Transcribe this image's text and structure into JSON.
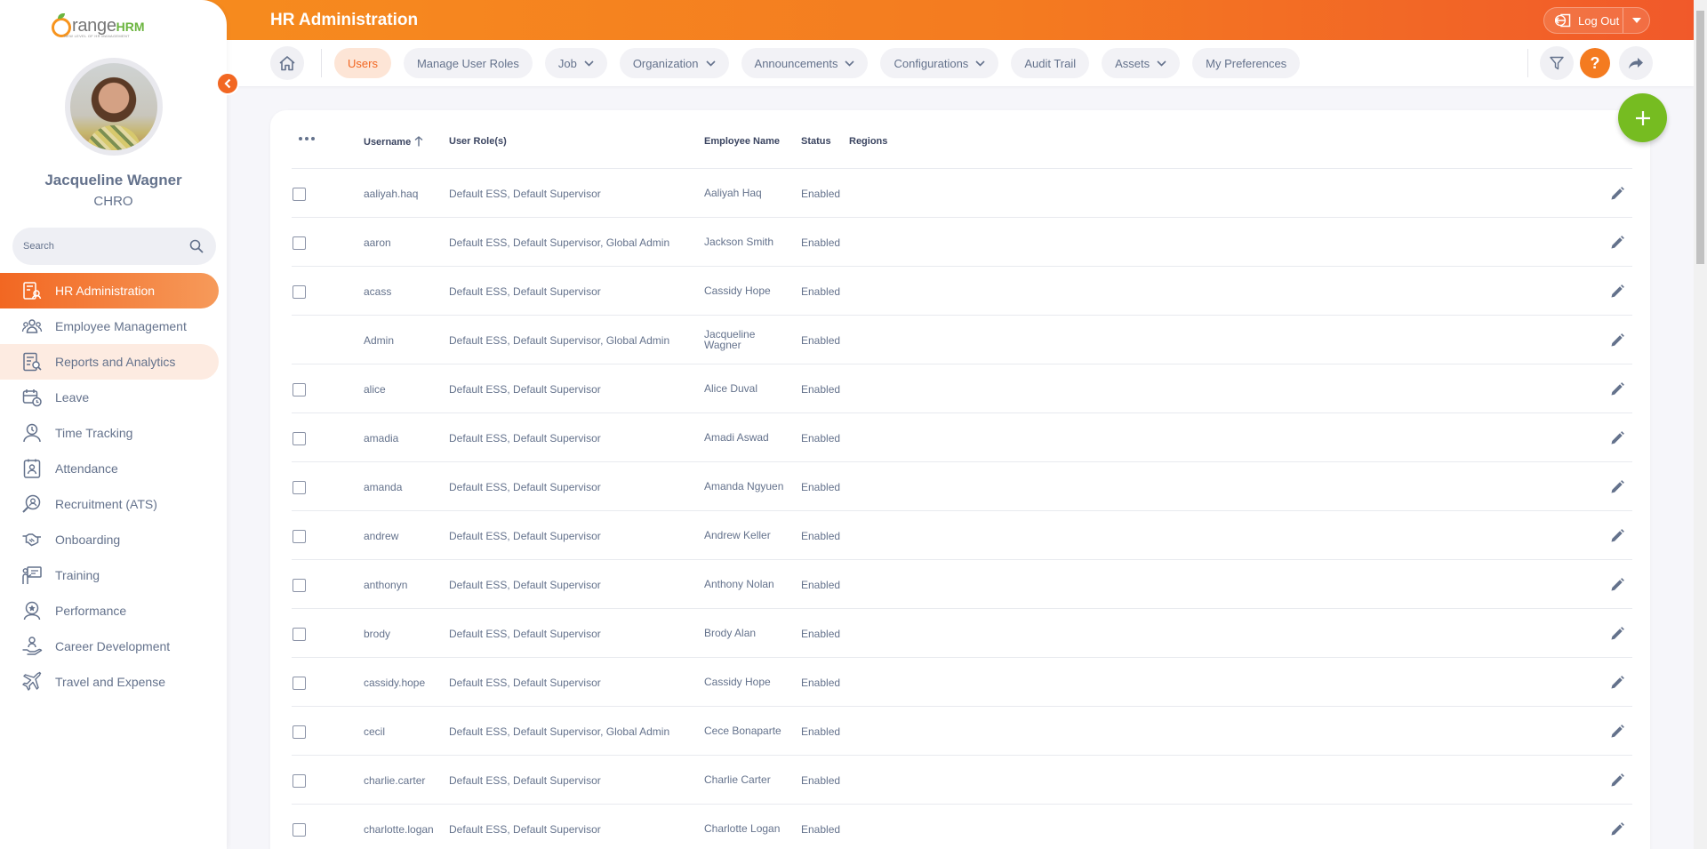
{
  "brand": {
    "word": "range",
    "suffix": "HRM",
    "tagline": "NEW LEVEL OF HR MANAGEMENT"
  },
  "user": {
    "name": "Jacqueline Wagner",
    "role": "CHRO"
  },
  "sidebar_search": {
    "placeholder": "Search"
  },
  "nav_items": [
    {
      "label": "HR Administration",
      "icon": "hr-admin-icon"
    },
    {
      "label": "Employee Management",
      "icon": "employees-icon"
    },
    {
      "label": "Reports and Analytics",
      "icon": "reports-icon"
    },
    {
      "label": "Leave",
      "icon": "leave-icon"
    },
    {
      "label": "Time Tracking",
      "icon": "time-icon"
    },
    {
      "label": "Attendance",
      "icon": "attendance-icon"
    },
    {
      "label": "Recruitment (ATS)",
      "icon": "recruitment-icon"
    },
    {
      "label": "Onboarding",
      "icon": "onboarding-icon"
    },
    {
      "label": "Training",
      "icon": "training-icon"
    },
    {
      "label": "Performance",
      "icon": "performance-icon"
    },
    {
      "label": "Career Development",
      "icon": "career-icon"
    },
    {
      "label": "Travel and Expense",
      "icon": "travel-icon"
    }
  ],
  "header": {
    "title": "HR Administration",
    "logout_label": "Log Out"
  },
  "tabs": [
    {
      "label": "Users",
      "dropdown": false
    },
    {
      "label": "Manage User Roles",
      "dropdown": false
    },
    {
      "label": "Job",
      "dropdown": true
    },
    {
      "label": "Organization",
      "dropdown": true
    },
    {
      "label": "Announcements",
      "dropdown": true
    },
    {
      "label": "Configurations",
      "dropdown": true
    },
    {
      "label": "Audit Trail",
      "dropdown": false
    },
    {
      "label": "Assets",
      "dropdown": true
    },
    {
      "label": "My Preferences",
      "dropdown": false
    }
  ],
  "help_label": "?",
  "table": {
    "columns": {
      "username": "Username",
      "roles": "User Role(s)",
      "employee": "Employee Name",
      "status": "Status",
      "regions": "Regions"
    },
    "rows": [
      {
        "username": "aaliyah.haq",
        "roles": "Default ESS, Default Supervisor",
        "employee": "Aaliyah Haq",
        "status": "Enabled",
        "checkbox": true
      },
      {
        "username": "aaron",
        "roles": "Default ESS, Default Supervisor, Global Admin",
        "employee": "Jackson Smith",
        "status": "Enabled",
        "checkbox": true
      },
      {
        "username": "acass",
        "roles": "Default ESS, Default Supervisor",
        "employee": "Cassidy Hope",
        "status": "Enabled",
        "checkbox": true
      },
      {
        "username": "Admin",
        "roles": "Default ESS, Default Supervisor, Global Admin",
        "employee": "Jacqueline Wagner",
        "status": "Enabled",
        "checkbox": false
      },
      {
        "username": "alice",
        "roles": "Default ESS, Default Supervisor",
        "employee": "Alice Duval",
        "status": "Enabled",
        "checkbox": true
      },
      {
        "username": "amadia",
        "roles": "Default ESS, Default Supervisor",
        "employee": "Amadi Aswad",
        "status": "Enabled",
        "checkbox": true
      },
      {
        "username": "amanda",
        "roles": "Default ESS, Default Supervisor",
        "employee": "Amanda Ngyuen",
        "status": "Enabled",
        "checkbox": true
      },
      {
        "username": "andrew",
        "roles": "Default ESS, Default Supervisor",
        "employee": "Andrew Keller",
        "status": "Enabled",
        "checkbox": true
      },
      {
        "username": "anthonyn",
        "roles": "Default ESS, Default Supervisor",
        "employee": "Anthony Nolan",
        "status": "Enabled",
        "checkbox": true
      },
      {
        "username": "brody",
        "roles": "Default ESS, Default Supervisor",
        "employee": "Brody Alan",
        "status": "Enabled",
        "checkbox": true
      },
      {
        "username": "cassidy.hope",
        "roles": "Default ESS, Default Supervisor",
        "employee": "Cassidy Hope",
        "status": "Enabled",
        "checkbox": true
      },
      {
        "username": "cecil",
        "roles": "Default ESS, Default Supervisor, Global Admin",
        "employee": "Cece Bonaparte",
        "status": "Enabled",
        "checkbox": true
      },
      {
        "username": "charlie.carter",
        "roles": "Default ESS, Default Supervisor",
        "employee": "Charlie Carter",
        "status": "Enabled",
        "checkbox": true
      },
      {
        "username": "charlotte.logan",
        "roles": "Default ESS, Default Supervisor",
        "employee": "Charlotte Logan",
        "status": "Enabled",
        "checkbox": true
      }
    ]
  },
  "colors": {
    "brand_orange": "#f47b20",
    "accent_green": "#76bc21",
    "text": "#64728c"
  }
}
